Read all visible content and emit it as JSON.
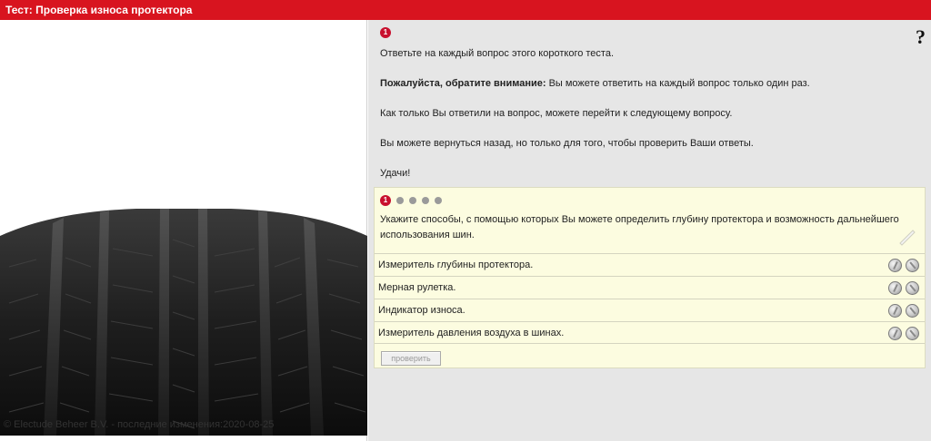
{
  "title": "Тест: Проверка износа протектора",
  "copyright": "© Electude Beheer B.V. - последние изменения:2020-08-25",
  "help_icon": "?",
  "step": "1",
  "intro": {
    "line1": "Ответьте на каждый вопрос этого короткого теста.",
    "attention_bold": "Пожалуйста, обратите внимание:",
    "attention_rest": " Вы можете ответить на каждый вопрос только один раз.",
    "line3": "Как только Вы ответили на вопрос, можете перейти к следующему вопросу.",
    "line4": "Вы можете вернуться назад, но только для того, чтобы проверить Ваши ответы.",
    "line5": "Удачи!"
  },
  "question": {
    "number": "1",
    "text": "Укажите способы, с помощью которых Вы можете определить глубину протектора и возможность дальнейшего использования шин.",
    "answers": [
      "Измеритель глубины протектора.",
      "Мерная рулетка.",
      "Индикатор износа.",
      "Измеритель давления воздуха в шинах."
    ],
    "check_label": "проверить"
  },
  "colors": {
    "titlebar": "#d8141f",
    "right_panel_bg": "#e6e6e6",
    "question_bg": "#fcfce0",
    "badge": "#c8102e"
  }
}
